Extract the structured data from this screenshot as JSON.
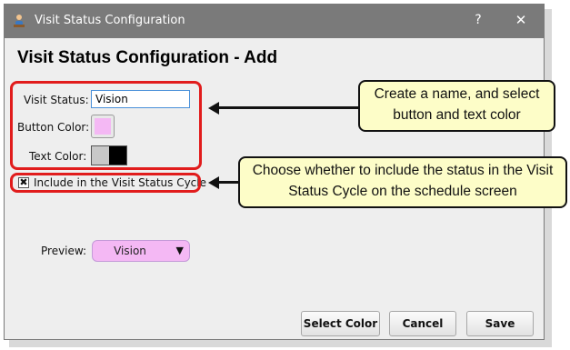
{
  "window": {
    "title": "Visit Status Configuration",
    "help_glyph": "?",
    "close_glyph": "✕"
  },
  "heading": "Visit Status Configuration - Add",
  "form": {
    "visit_status_label": "Visit Status:",
    "visit_status_value": "Vision",
    "button_color_label": "Button Color:",
    "button_color": "#f4b8f4",
    "text_color_label": "Text Color:",
    "text_color_options": [
      "#c8c8c8",
      "#000000"
    ],
    "include_cycle_label": "Include in the Visit Status Cycle",
    "include_cycle_checked": true,
    "include_cycle_glyph": "✖",
    "preview_label": "Preview:",
    "preview_text": "Vision",
    "preview_arrow": "▼"
  },
  "buttons": {
    "select_color": "Select Color",
    "cancel": "Cancel",
    "save": "Save"
  },
  "callouts": {
    "name_color": "Create a name, and select button and text color",
    "cycle": "Choose whether to include the status in the Visit Status Cycle on the schedule screen",
    "fill_color": "#fdfdc8",
    "highlight_color": "#e11c1c"
  }
}
